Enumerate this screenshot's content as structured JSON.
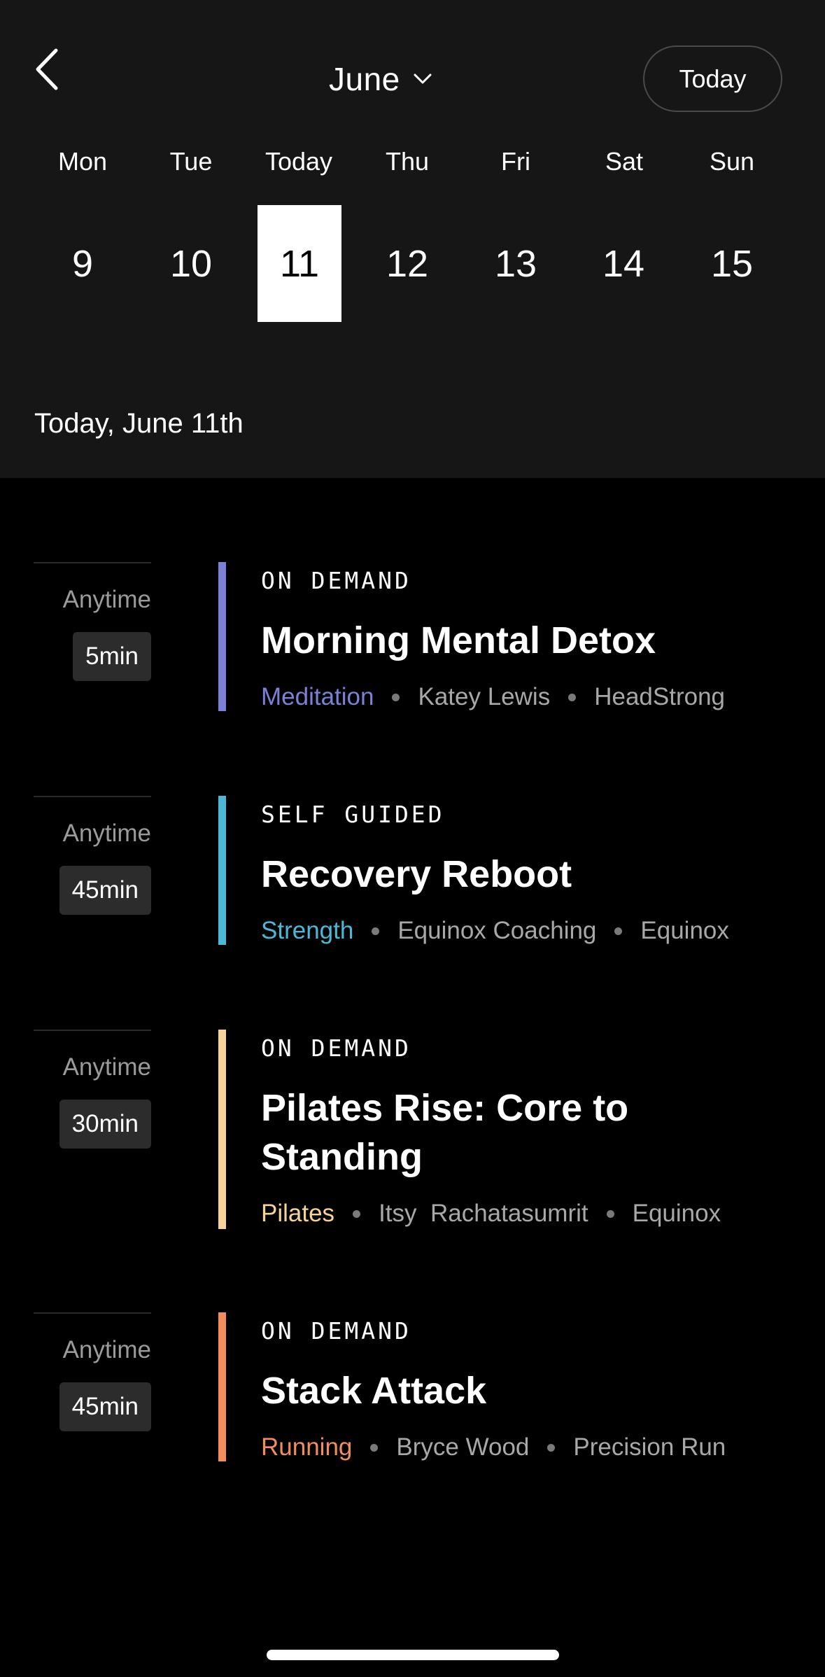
{
  "header": {
    "month": "June",
    "today_button": "Today",
    "weekdays": [
      "Mon",
      "Tue",
      "Today",
      "Thu",
      "Fri",
      "Sat",
      "Sun"
    ],
    "dates": [
      "9",
      "10",
      "11",
      "12",
      "13",
      "14",
      "15"
    ],
    "selected_index": 2,
    "date_heading": "Today, June 11th"
  },
  "schedule": [
    {
      "time": "Anytime",
      "duration": "5min",
      "type": "ON DEMAND",
      "title": "Morning Mental Detox",
      "category": "Meditation",
      "instructor": "Katey Lewis",
      "brand": "HeadStrong",
      "accent_color": "#7b82d6"
    },
    {
      "time": "Anytime",
      "duration": "45min",
      "type": "SELF GUIDED",
      "title": "Recovery Reboot",
      "category": "Strength",
      "instructor": "Equinox Coaching",
      "brand": "Equinox",
      "accent_color": "#4bb8d8"
    },
    {
      "time": "Anytime",
      "duration": "30min",
      "type": "ON DEMAND",
      "title": "Pilates Rise: Core to Standing",
      "category": "Pilates",
      "instructor": "Itsy  Rachatasumrit",
      "brand": "Equinox",
      "accent_color": "#f6d398"
    },
    {
      "time": "Anytime",
      "duration": "45min",
      "type": "ON DEMAND",
      "title": "Stack Attack",
      "category": "Running",
      "instructor": "Bryce Wood",
      "brand": "Precision Run",
      "accent_color": "#f28d5c"
    }
  ],
  "icons": {
    "back": "chevron-left-icon",
    "month_dropdown": "chevron-down-icon"
  }
}
